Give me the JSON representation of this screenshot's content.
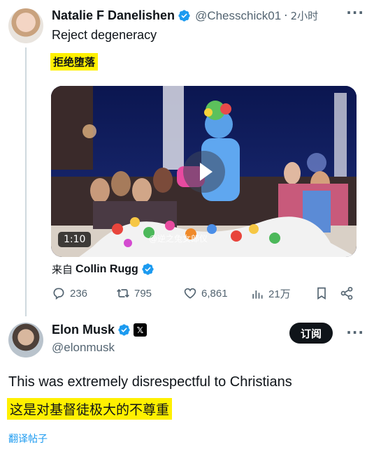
{
  "tweet1": {
    "author_name": "Natalie F Danelishen",
    "handle": "@Chesschick01",
    "separator": "·",
    "time": "2小时",
    "text": "Reject degeneracy",
    "translation": "拒绝堕落",
    "video": {
      "duration": "1:10",
      "watermark": "@逆之兔女郎仪"
    },
    "from_label": "来自",
    "from_name": "Collin Rugg",
    "stats": {
      "replies": "236",
      "retweets": "795",
      "likes": "6,861",
      "views": "21万"
    }
  },
  "tweet2": {
    "author_name": "Elon Musk",
    "x_badge": "𝕏",
    "handle": "@elonmusk",
    "subscribe_label": "订阅",
    "text": "This was extremely disrespectful to Christians",
    "translation": "这是对基督徒极大的不尊重",
    "translate_link": "翻译帖子"
  },
  "more_label": "···",
  "colors": {
    "verified": "#1d9bf0",
    "highlight": "#fff000",
    "link": "#1d9bf0"
  }
}
